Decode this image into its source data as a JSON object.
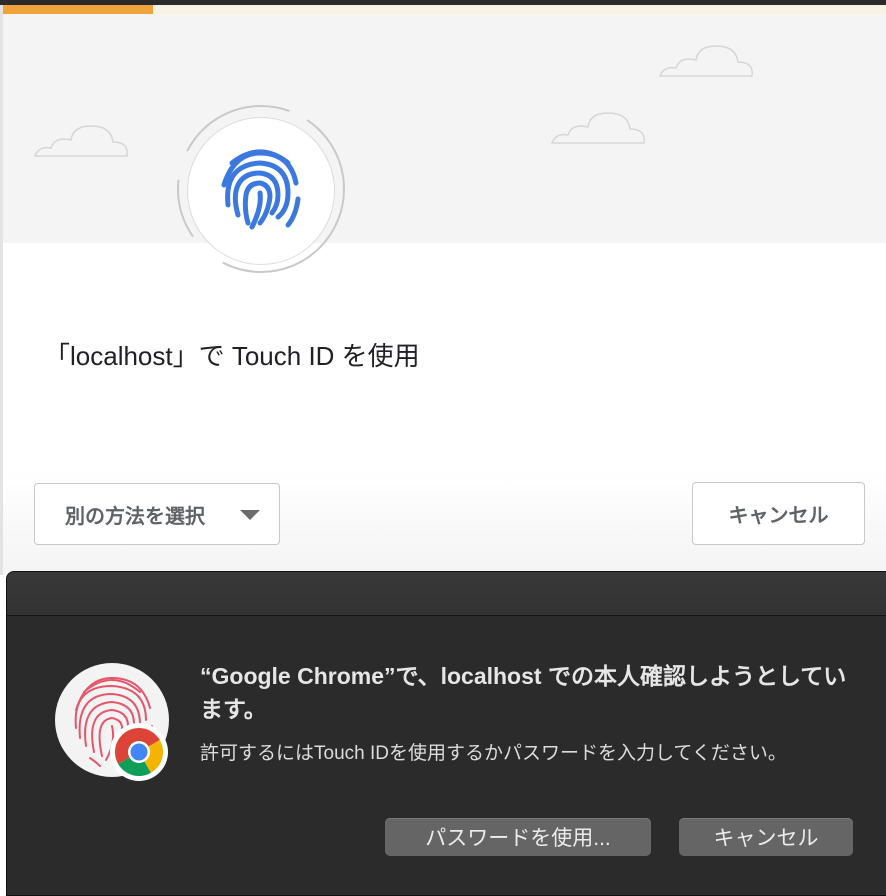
{
  "webauthn_dialog": {
    "progress": 0.17,
    "title": "「localhost」で Touch ID を使用",
    "other_method_label": "別の方法を選択",
    "cancel_label": "キャンセル"
  },
  "touchid_sheet": {
    "heading": "“Google Chrome”で、localhost での本人確認しようとしています。",
    "description": "許可するにはTouch IDを使用するかパスワードを入力してください。",
    "use_password_label": "パスワードを使用...",
    "cancel_label": "キャンセル"
  },
  "icons": {
    "fingerprint": "fingerprint-icon",
    "touch_id": "touch-id-icon",
    "chrome_badge": "chrome-logo-icon",
    "dropdown": "caret-down-icon"
  },
  "colors": {
    "progress": "#f0a33a",
    "fingerprint_blue": "#3b78e0",
    "touchid_red": "#e5566b",
    "sheet_bg": "#2b2b2b"
  }
}
